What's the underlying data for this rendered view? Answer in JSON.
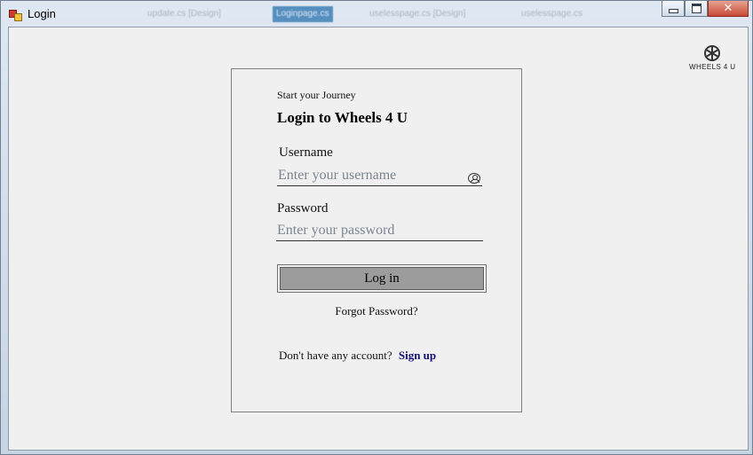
{
  "window": {
    "title": "Login",
    "background_tabs": [
      "update.cs [Design]",
      "Loginpage.cs",
      "uselesspage.cs [Design]",
      "uselesspage.cs"
    ]
  },
  "logo": {
    "text": "WHEELS 4 U",
    "icon": "wheel-icon"
  },
  "form": {
    "subtitle": "Start your Journey",
    "heading": "Login to Wheels 4 U",
    "username_label": "Username",
    "username_placeholder": "Enter your username",
    "username_value": "",
    "password_label": "Password",
    "password_placeholder": "Enter your password",
    "password_value": "",
    "login_button": "Log in",
    "forgot_password": "Forgot Password?",
    "no_account_text": "Don't have any account?",
    "signup_link": "Sign up"
  },
  "colors": {
    "client_bg": "#f0f0f0",
    "button_fill": "#9c9c9c",
    "link": "#12127a",
    "close_button": "#c74a35"
  }
}
